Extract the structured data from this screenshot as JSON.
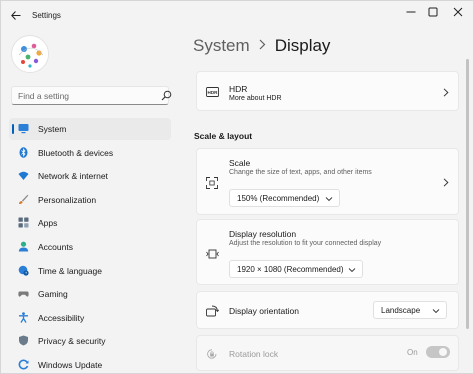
{
  "window": {
    "title": "Settings"
  },
  "sidebar": {
    "search_placeholder": "Find a setting",
    "items": [
      {
        "label": "System",
        "icon": "monitor-icon",
        "color": "#2b7fd6",
        "active": true
      },
      {
        "label": "Bluetooth & devices",
        "icon": "bluetooth-icon",
        "color": "#1f78d1"
      },
      {
        "label": "Network & internet",
        "icon": "wifi-icon",
        "color": "#1f78d1"
      },
      {
        "label": "Personalization",
        "icon": "brush-icon",
        "color": "#d67b2b"
      },
      {
        "label": "Apps",
        "icon": "apps-icon",
        "color": "#5a6b7c"
      },
      {
        "label": "Accounts",
        "icon": "person-icon",
        "color": "#2bb08b"
      },
      {
        "label": "Time & language",
        "icon": "globe-clock-icon",
        "color": "#2b7fd6"
      },
      {
        "label": "Gaming",
        "icon": "controller-icon",
        "color": "#7a7a7a"
      },
      {
        "label": "Accessibility",
        "icon": "accessibility-icon",
        "color": "#2b7fd6"
      },
      {
        "label": "Privacy & security",
        "icon": "shield-icon",
        "color": "#6b7b8c"
      },
      {
        "label": "Windows Update",
        "icon": "update-icon",
        "color": "#2b7fd6"
      }
    ]
  },
  "breadcrumb": {
    "parent": "System",
    "current": "Display"
  },
  "main": {
    "hdr": {
      "title": "HDR",
      "link": "More about HDR"
    },
    "section_heading": "Scale & layout",
    "scale": {
      "title": "Scale",
      "subtitle": "Change the size of text, apps, and other items",
      "value": "150% (Recommended)"
    },
    "resolution": {
      "title": "Display resolution",
      "subtitle": "Adjust the resolution to fit your connected display",
      "value": "1920 × 1080 (Recommended)"
    },
    "orientation": {
      "title": "Display orientation",
      "value": "Landscape"
    },
    "rotation_lock": {
      "title": "Rotation lock",
      "state": "On",
      "enabled": false
    }
  },
  "colors": {
    "accent": "#005fb8",
    "background": "#f3f3f3",
    "card": "#fbfbfb"
  }
}
